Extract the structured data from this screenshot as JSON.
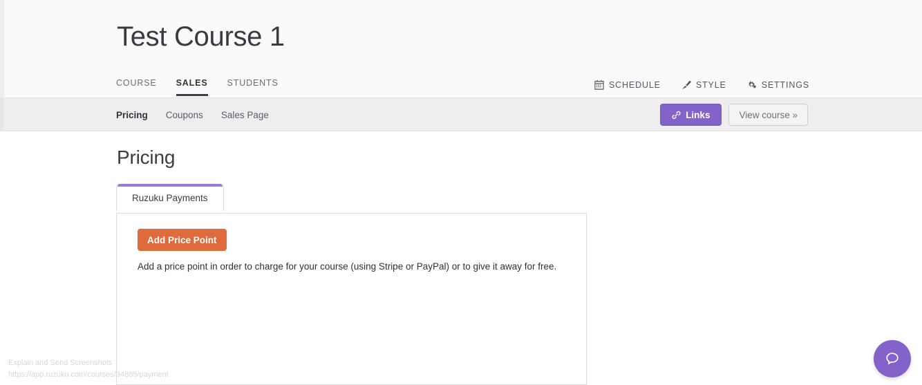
{
  "header": {
    "course_title": "Test Course 1",
    "main_tabs": [
      {
        "label": "COURSE",
        "active": false
      },
      {
        "label": "SALES",
        "active": true
      },
      {
        "label": "STUDENTS",
        "active": false
      }
    ],
    "actions": [
      {
        "label": "SCHEDULE",
        "icon": "calendar-icon"
      },
      {
        "label": "STYLE",
        "icon": "paintbrush-icon"
      },
      {
        "label": "SETTINGS",
        "icon": "gears-icon"
      }
    ]
  },
  "subnav": {
    "links": [
      {
        "label": "Pricing",
        "active": true
      },
      {
        "label": "Coupons",
        "active": false
      },
      {
        "label": "Sales Page",
        "active": false
      }
    ],
    "links_button": "Links",
    "links_button_icon": "chain-link-icon",
    "view_course_button": "View course »"
  },
  "main": {
    "page_title": "Pricing",
    "panel_tab": "Ruzuku Payments",
    "add_price_point_button": "Add Price Point",
    "description": "Add a price point in order to charge for your course (using Stripe or PayPal) or to give it away for free."
  },
  "overlay": {
    "line1": "Explain and Send Screenshots",
    "line2": "https://app.ruzuku.com/courses/34885/payment"
  },
  "chat": {
    "icon": "chat-bubble-icon"
  },
  "colors": {
    "purple": "#8362c9",
    "tab_purple": "#9b79d6",
    "orange": "#dd6b3d",
    "header_bg": "#fafafa",
    "subnav_bg": "#eeeeee",
    "text_dark": "#33333c"
  }
}
